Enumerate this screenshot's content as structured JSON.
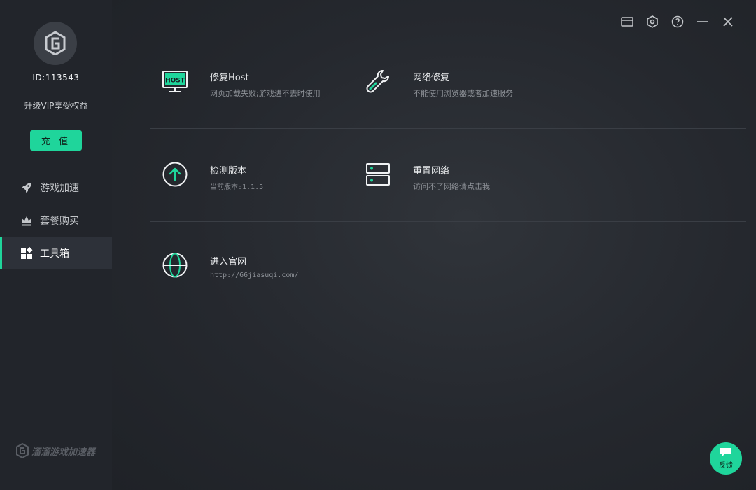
{
  "sidebar": {
    "user_id": "ID:113543",
    "vip_text": "升级VIP享受权益",
    "recharge_label": "充 值",
    "nav": [
      {
        "label": "游戏加速",
        "icon": "rocket-icon"
      },
      {
        "label": "套餐购买",
        "icon": "crown-icon"
      },
      {
        "label": "工具箱",
        "icon": "grid-icon"
      }
    ],
    "brand": "溜溜游戏加速器"
  },
  "window": {
    "controls": [
      "mail-icon",
      "settings-icon",
      "help-icon",
      "minimize-icon",
      "close-icon"
    ]
  },
  "tools": [
    {
      "title": "修复Host",
      "desc": "网页加载失败;游戏进不去时使用",
      "icon": "host-monitor-icon"
    },
    {
      "title": "网络修复",
      "desc": "不能使用浏览器或者加速服务",
      "icon": "wrench-icon"
    },
    {
      "title": "检测版本",
      "desc": "当前版本:1.1.5",
      "icon": "upload-arrow-icon"
    },
    {
      "title": "重置网络",
      "desc": "访问不了网络请点击我",
      "icon": "server-icon"
    },
    {
      "title": "进入官网",
      "desc": "http://66jiasuqi.com/",
      "icon": "globe-icon"
    }
  ],
  "feedback_label": "反馈",
  "colors": {
    "accent": "#1fd59b",
    "sidebar_bg": "#22252b",
    "active_bg": "#2d3139"
  }
}
